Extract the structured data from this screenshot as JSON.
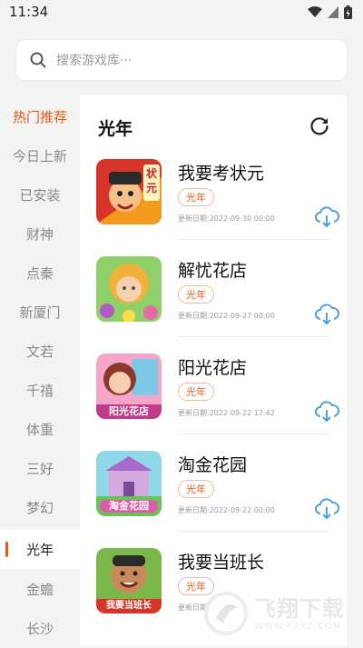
{
  "status_bar": {
    "time": "11:34"
  },
  "search": {
    "placeholder": "搜索游戏库···"
  },
  "sidebar": {
    "items": [
      {
        "label": "热门推荐"
      },
      {
        "label": "今日上新"
      },
      {
        "label": "已安装"
      },
      {
        "label": "财神"
      },
      {
        "label": "点秦"
      },
      {
        "label": "新厦门"
      },
      {
        "label": "文若"
      },
      {
        "label": "千禧"
      },
      {
        "label": "体重"
      },
      {
        "label": "三好"
      },
      {
        "label": "梦幻"
      },
      {
        "label": "光年"
      },
      {
        "label": "金蟾"
      },
      {
        "label": "长沙"
      }
    ],
    "active_label": "光年"
  },
  "main": {
    "title": "光年",
    "games": [
      {
        "name": "我要考状元",
        "tag": "光年",
        "date": "更新日期:2022-09-30 00:00",
        "thumb_text": "状元"
      },
      {
        "name": "解忧花店",
        "tag": "光年",
        "date": "更新日期:2022-09-27 00:00",
        "thumb_text": ""
      },
      {
        "name": "阳光花店",
        "tag": "光年",
        "date": "更新日期:2022-09-22 17:42",
        "thumb_text": "阳光花店"
      },
      {
        "name": "淘金花园",
        "tag": "光年",
        "date": "更新日期:2022-09-22 00:00",
        "thumb_text": "淘金花园"
      },
      {
        "name": "我要当班长",
        "tag": "光年",
        "date": "更新日期:",
        "thumb_text": "我要当班长"
      }
    ]
  },
  "watermark": {
    "text": "飞翔下载",
    "url": "WWW.FXXZ.COM"
  },
  "colors": {
    "accent": "#e05a1a",
    "download": "#3a9ad9"
  }
}
